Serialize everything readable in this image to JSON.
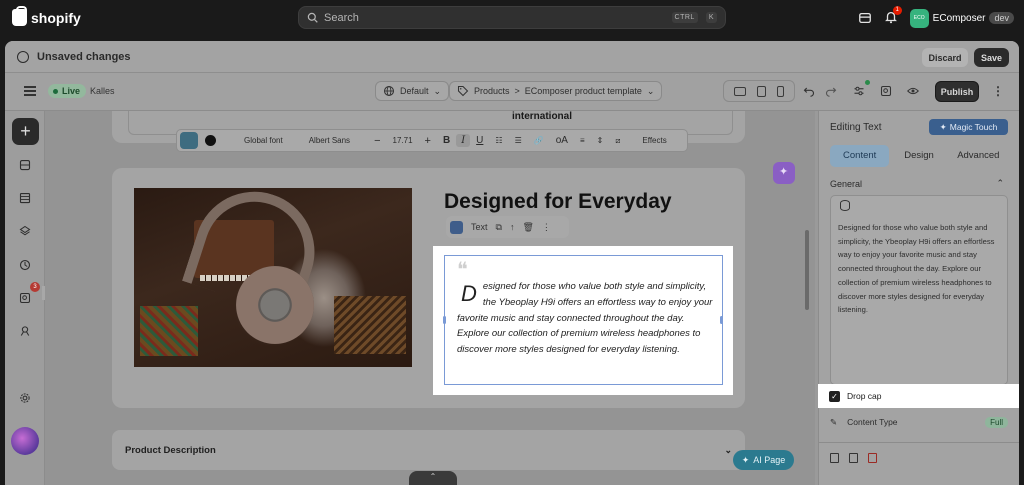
{
  "topbar": {
    "brand": "shopify",
    "search_placeholder": "Search",
    "shortcut_ctrl": "CTRL",
    "shortcut_key": "K",
    "notification_count": "1",
    "store_avatar": "ECO",
    "store_name": "EComposer",
    "store_badge": "dev"
  },
  "unsaved": {
    "title": "Unsaved changes",
    "discard_label": "Discard",
    "save_label": "Save"
  },
  "editor": {
    "status": "Live",
    "theme_name": "Kalles",
    "layout_select": "Default",
    "breadcrumb_parent": "Products",
    "breadcrumb_separator": ">",
    "breadcrumb_current": "EComposer product template",
    "publish_label": "Publish"
  },
  "rail": {
    "badge_count": "3"
  },
  "format_toolbar": {
    "font_scope": "Global font",
    "font_family": "Albert Sans",
    "minus": "−",
    "font_size": "17.71",
    "plus": "+",
    "bold": "B",
    "italic": "I",
    "underline": "U",
    "case": "oA",
    "effects": "Effects"
  },
  "canvas": {
    "top_card_text": "international",
    "heading": "Designed for Everyday",
    "element_label": "Text",
    "quote_mark": "❝",
    "drop_cap_letter": "D",
    "body_text": "esigned for those who value both style and simplicity, the Ybeoplay H9i offers an effortless way to enjoy your favorite music and stay connected throughout the day. Explore our collection of premium wireless headphones to discover more styles designed for everyday listening.",
    "product_description_label": "Product Description",
    "ai_page_label": "AI Page"
  },
  "panel": {
    "title": "Editing Text",
    "magic_touch": "Magic Touch",
    "tabs": [
      {
        "label": "Content",
        "active": true
      },
      {
        "label": "Design",
        "active": false
      },
      {
        "label": "Advanced",
        "active": false
      }
    ],
    "section_general": "General",
    "text_value": "Designed for those who value both style and simplicity, the Ybeoplay H9i offers an effortless way to enjoy your favorite music and stay connected throughout the day. Explore our collection of premium wireless headphones to discover more styles designed for everyday listening.",
    "drop_cap_label": "Drop cap",
    "drop_cap_checked": true,
    "content_type_label": "Content Type",
    "content_type_value": "Full"
  },
  "colors": {
    "accent_green": "#36b37e",
    "highlight_white": "#ffffff",
    "selection_blue": "#7a9ad6"
  }
}
